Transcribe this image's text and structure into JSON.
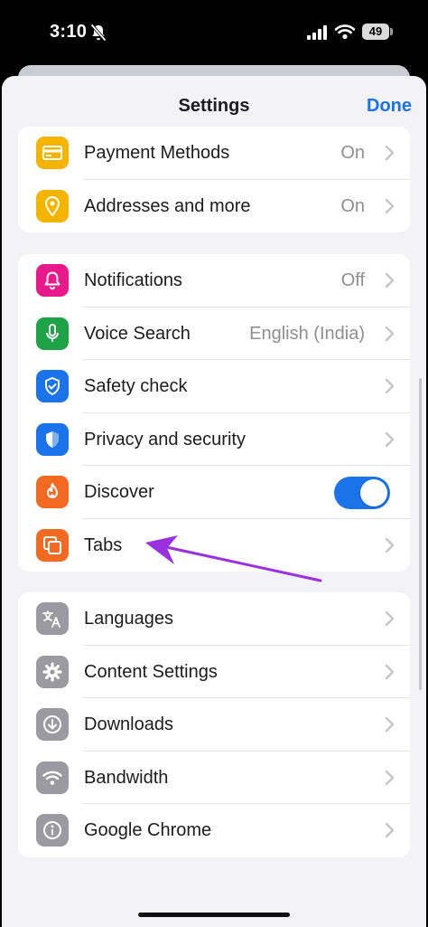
{
  "status_bar": {
    "time": "3:10",
    "battery": "49"
  },
  "header": {
    "title": "Settings",
    "done_label": "Done"
  },
  "groups": [
    {
      "items": [
        {
          "label": "Payment Methods",
          "value": "On",
          "icon": "credit-card-icon",
          "color": "#f4b400"
        },
        {
          "label": "Addresses and more",
          "value": "On",
          "icon": "location-pin-icon",
          "color": "#f4b400"
        }
      ]
    },
    {
      "items": [
        {
          "label": "Notifications",
          "value": "Off",
          "icon": "bell-icon",
          "color": "#e8198b"
        },
        {
          "label": "Voice Search",
          "value": "English (India)",
          "icon": "microphone-icon",
          "color": "#1ea446"
        },
        {
          "label": "Safety check",
          "value": "",
          "icon": "shield-check-icon",
          "color": "#1a73e8"
        },
        {
          "label": "Privacy and security",
          "value": "",
          "icon": "shield-icon",
          "color": "#1a73e8"
        },
        {
          "label": "Discover",
          "value": "",
          "icon": "flame-icon",
          "color": "#f26a21",
          "toggle": true
        },
        {
          "label": "Tabs",
          "value": "",
          "icon": "tabs-icon",
          "color": "#f26a21"
        }
      ]
    },
    {
      "items": [
        {
          "label": "Languages",
          "value": "",
          "icon": "translate-icon",
          "color": "#9a9aa0"
        },
        {
          "label": "Content Settings",
          "value": "",
          "icon": "gear-icon",
          "color": "#9a9aa0"
        },
        {
          "label": "Downloads",
          "value": "",
          "icon": "download-icon",
          "color": "#9a9aa0"
        },
        {
          "label": "Bandwidth",
          "value": "",
          "icon": "wifi-icon",
          "color": "#9a9aa0"
        },
        {
          "label": "Google Chrome",
          "value": "",
          "icon": "info-icon",
          "color": "#9a9aa0"
        }
      ]
    }
  ],
  "colors": {
    "accent": "#1a73e8",
    "annotation_arrow": "#9b30e0"
  }
}
